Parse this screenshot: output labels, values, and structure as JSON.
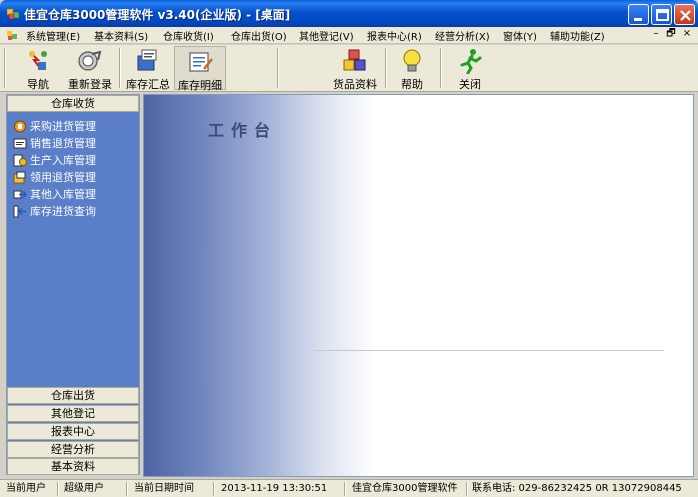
{
  "window": {
    "title": "佳宜仓库3000管理软件 v3.40(企业版) - [桌面]"
  },
  "menu": {
    "items": [
      {
        "label": "系统管理(E)"
      },
      {
        "label": "基本资料(S)"
      },
      {
        "label": "仓库收货(I)"
      },
      {
        "label": "仓库出货(O)"
      },
      {
        "label": "其他登记(V)"
      },
      {
        "label": "报表中心(R)"
      },
      {
        "label": "经营分析(X)"
      },
      {
        "label": "窗体(Y)"
      },
      {
        "label": "辅助功能(Z)"
      }
    ],
    "mdi_controls": [
      "–",
      "🗗",
      "×"
    ]
  },
  "toolbar": {
    "buttons": [
      {
        "label": "导航",
        "icon": "navigation-icon"
      },
      {
        "label": "重新登录",
        "icon": "relogin-icon"
      },
      {
        "label": "库存汇总",
        "icon": "inventory-summary-icon"
      },
      {
        "label": "库存明细",
        "icon": "inventory-detail-icon"
      },
      {
        "label": "货品资料",
        "icon": "goods-info-icon"
      },
      {
        "label": "帮助",
        "icon": "lightbulb-icon"
      },
      {
        "label": "关闭",
        "icon": "running-man-icon"
      }
    ]
  },
  "sidebar": {
    "active_group": "仓库收货",
    "items": [
      {
        "label": "采购进货管理",
        "icon": "purchase-icon"
      },
      {
        "label": "销售退货管理",
        "icon": "sales-return-icon"
      },
      {
        "label": "生产入库管理",
        "icon": "production-icon"
      },
      {
        "label": "领用退货管理",
        "icon": "requisition-return-icon"
      },
      {
        "label": "其他入库管理",
        "icon": "other-inbound-icon"
      },
      {
        "label": "库存进货查询",
        "icon": "query-icon"
      }
    ],
    "groups": [
      {
        "label": "仓库出货"
      },
      {
        "label": "其他登记"
      },
      {
        "label": "报表中心"
      },
      {
        "label": "经营分析"
      },
      {
        "label": "基本资料"
      }
    ]
  },
  "workspace": {
    "title": "工作台"
  },
  "status": {
    "user_label": "当前用户",
    "user_value": "超级用户",
    "datetime_label": "当前日期时间",
    "datetime_value": "2013-11-19 13:30:51",
    "product": "佳宜仓库3000管理软件",
    "contact": "联系电话: 029-86232425 0R 13072908445"
  },
  "colors": {
    "titlebar": "#0552d0",
    "sidebar": "#5a7ec8",
    "chrome": "#ece9d8"
  }
}
